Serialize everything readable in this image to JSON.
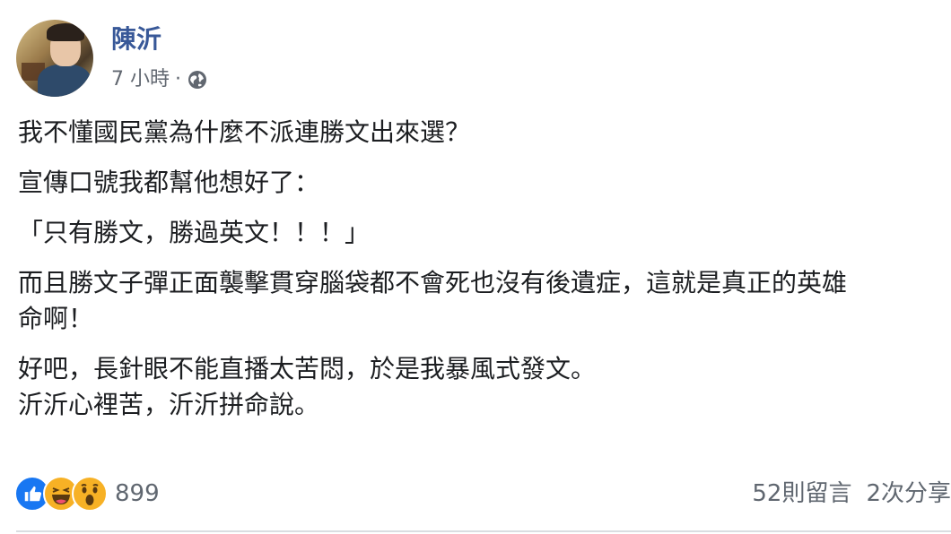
{
  "post": {
    "author": "陳沂",
    "time": "7 小時",
    "separator": "·",
    "privacy_icon": "globe-icon",
    "paragraphs": [
      "我不懂國民黨為什麼不派連勝文出來選？",
      "宣傳口號我都幫他想好了：",
      "「只有勝文，勝過英文！！！」",
      "而且勝文子彈正面襲擊貫穿腦袋都不會死也沒有後遺症，這就是真正的英雄",
      "命啊！",
      "好吧，長針眼不能直播太苦悶，於是我暴風式發文。",
      "沂沂心裡苦，沂沂拼命說。"
    ]
  },
  "footer": {
    "reaction_icons": [
      "like-icon",
      "haha-icon",
      "wow-icon"
    ],
    "reaction_count": "899",
    "comments": "52則留言",
    "shares": "2次分享"
  },
  "colors": {
    "author": "#385898",
    "meta": "#616770",
    "like": "#1877f2",
    "emoji": "#f7b125"
  }
}
